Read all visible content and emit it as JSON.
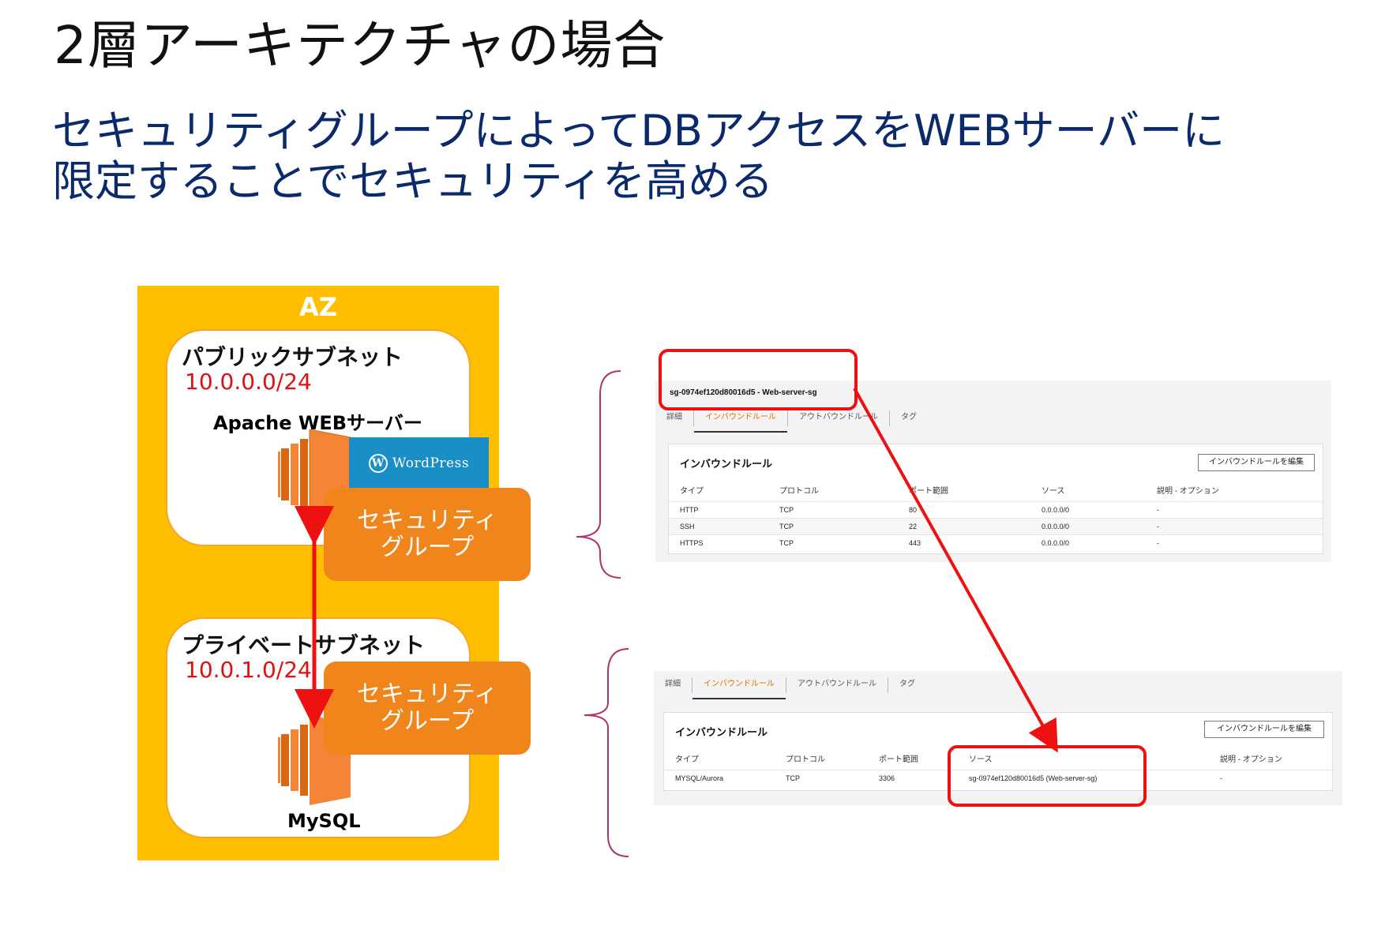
{
  "title": "2層アーキテクチャの場合",
  "subtitle": [
    "セキュリティグループによってDBアクセスをWEBサーバーに",
    "限定することでセキュリティを高める"
  ],
  "diagram": {
    "az_label": "AZ",
    "public_subnet": {
      "title": "パブリックサブネット",
      "cidr": "10.0.0.0/24"
    },
    "private_subnet": {
      "title": "プライベートサブネット",
      "cidr": "10.0.1.0/24"
    },
    "web_server_label": "Apache WEBサーバー",
    "wordpress_label": "WordPress",
    "db_label": "MySQL",
    "security_group_label": [
      "セキュリティ",
      "グループ"
    ]
  },
  "colors": {
    "az": "#ffbf00",
    "security_group": "#f0851c",
    "highlight": "#ee1111",
    "subtitle": "#0a2a6b",
    "cidr": "#e01010"
  },
  "web_sg": {
    "group_name": "sg-0974ef120d80016d5 - Web-server-sg",
    "tabs": [
      "詳細",
      "インバウンドルール",
      "アウトバウンドルール",
      "タグ"
    ],
    "active_tab": "インバウンドルール",
    "panel_title": "インバウンドルール",
    "edit_button": "インバウンドルールを編集",
    "columns": [
      "タイプ",
      "プロトコル",
      "ポート範囲",
      "ソース",
      "説明 - オプション"
    ],
    "rows": [
      [
        "HTTP",
        "TCP",
        "80",
        "0.0.0.0/0",
        "-"
      ],
      [
        "SSH",
        "TCP",
        "22",
        "0.0.0.0/0",
        "-"
      ],
      [
        "HTTPS",
        "TCP",
        "443",
        "0.0.0.0/0",
        "-"
      ]
    ]
  },
  "db_sg": {
    "tabs": [
      "詳細",
      "インバウンドルール",
      "アウトバウンドルール",
      "タグ"
    ],
    "active_tab": "インバウンドルール",
    "panel_title": "インバウンドルール",
    "edit_button": "インバウンドルールを編集",
    "columns": [
      "タイプ",
      "プロトコル",
      "ポート範囲",
      "ソース",
      "説明 - オプション"
    ],
    "rows": [
      [
        "MYSQL/Aurora",
        "TCP",
        "3306",
        "sg-0974ef120d80016d5 (Web-server-sg)",
        "-"
      ]
    ]
  }
}
